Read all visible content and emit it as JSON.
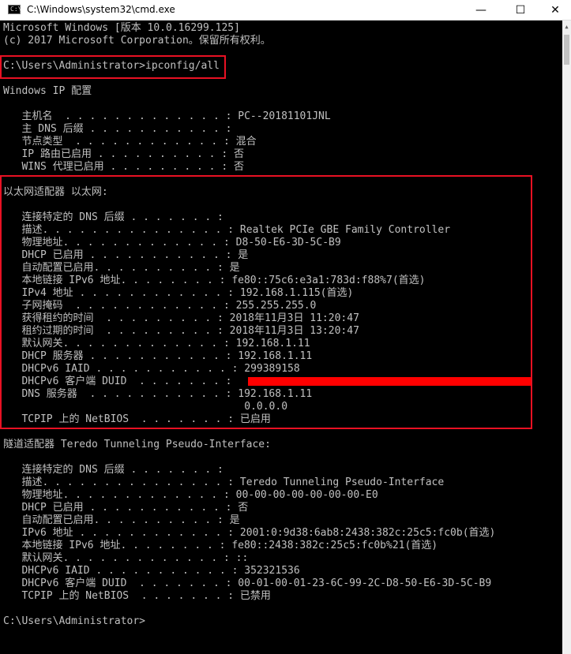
{
  "window": {
    "title": "C:\\Windows\\system32\\cmd.exe",
    "icon": "cmd-icon",
    "icon_glyph": "C:\\",
    "buttons": {
      "minimize": "—",
      "maximize": "☐",
      "close": "✕"
    }
  },
  "console": {
    "lines": [
      "Microsoft Windows [版本 10.0.16299.125]",
      "(c) 2017 Microsoft Corporation。保留所有权利。",
      "",
      "C:\\Users\\Administrator>ipconfig/all",
      "",
      "Windows IP 配置",
      "",
      "   主机名  . . . . . . . . . . . . . : PC--20181101JNL",
      "   主 DNS 后缀 . . . . . . . . . . . :",
      "   节点类型  . . . . . . . . . . . . : 混合",
      "   IP 路由已启用 . . . . . . . . . . : 否",
      "   WINS 代理已启用 . . . . . . . . . : 否",
      "",
      "以太网适配器 以太网:",
      "",
      "   连接特定的 DNS 后缀 . . . . . . . :",
      "   描述. . . . . . . . . . . . . . . : Realtek PCIe GBE Family Controller",
      "   物理地址. . . . . . . . . . . . . : D8-50-E6-3D-5C-B9",
      "   DHCP 已启用 . . . . . . . . . . . : 是",
      "   自动配置已启用. . . . . . . . . . : 是",
      "   本地链接 IPv6 地址. . . . . . . . : fe80::75c6:e3a1:783d:f88%7(首选)",
      "   IPv4 地址 . . . . . . . . . . . . : 192.168.1.115(首选)",
      "   子网掩码  . . . . . . . . . . . . : 255.255.255.0",
      "   获得租约的时间  . . . . . . . . . : 2018年11月3日 11:20:47",
      "   租约过期的时间  . . . . . . . . . : 2018年11月3日 13:20:47",
      "   默认网关. . . . . . . . . . . . . : 192.168.1.11",
      "   DHCP 服务器 . . . . . . . . . . . : 192.168.1.11",
      "   DHCPv6 IAID . . . . . . . . . . . : 299389158",
      "   DHCPv6 客户端 DUID  . . . . . . . :",
      "   DNS 服务器  . . . . . . . . . . . : 192.168.1.11",
      "                                       0.0.0.0",
      "   TCPIP 上的 NetBIOS  . . . . . . . : 已启用",
      "",
      "隧道适配器 Teredo Tunneling Pseudo-Interface:",
      "",
      "   连接特定的 DNS 后缀 . . . . . . . :",
      "   描述. . . . . . . . . . . . . . . : Teredo Tunneling Pseudo-Interface",
      "   物理地址. . . . . . . . . . . . . : 00-00-00-00-00-00-00-E0",
      "   DHCP 已启用 . . . . . . . . . . . : 否",
      "   自动配置已启用. . . . . . . . . . : 是",
      "   IPv6 地址 . . . . . . . . . . . . : 2001:0:9d38:6ab8:2438:382c:25c5:fc0b(首选)",
      "   本地链接 IPv6 地址. . . . . . . . : fe80::2438:382c:25c5:fc0b%21(首选)",
      "   默认网关. . . . . . . . . . . . . : ::",
      "   DHCPv6 IAID . . . . . . . . . . . : 352321536",
      "   DHCPv6 客户端 DUID  . . . . . . . : 00-01-00-01-23-6C-99-2C-D8-50-E6-3D-5C-B9",
      "   TCPIP 上的 NetBIOS  . . . . . . . : 已禁用",
      "",
      "C:\\Users\\Administrator>"
    ]
  },
  "colors": {
    "console_bg": "#000000",
    "console_text": "#c0c0c0",
    "highlight_border": "#e81123",
    "redaction": "#ff0000"
  }
}
